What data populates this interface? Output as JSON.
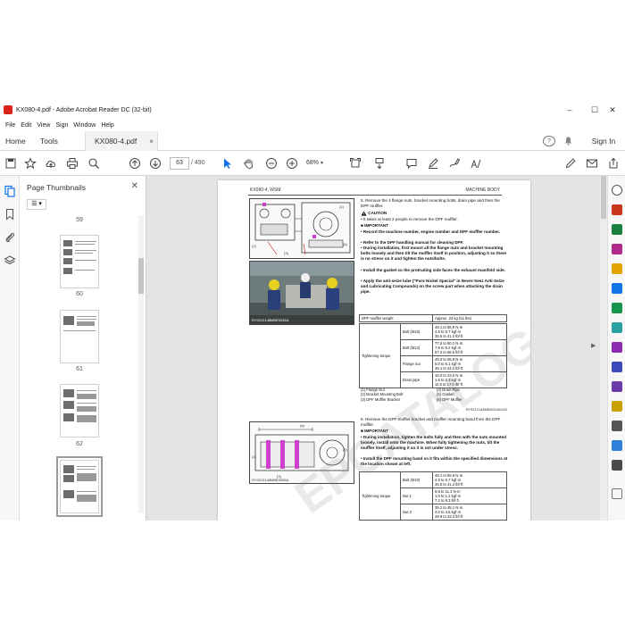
{
  "window": {
    "title": "KX080-4.pdf - Adobe Acrobat Reader DC (32-bit)",
    "controls": [
      "–",
      "☐",
      "✕"
    ]
  },
  "menu": [
    "File",
    "Edit",
    "View",
    "Sign",
    "Window",
    "Help"
  ],
  "tabs": {
    "home": "Home",
    "tools": "Tools",
    "document": "KX080-4.pdf",
    "close_glyph": "×",
    "help_glyph": "?",
    "signin": "Sign In"
  },
  "toolbar": {
    "current_page": "63",
    "page_total": "/ 490",
    "zoom": "68%"
  },
  "thumbnails": {
    "title": "Page Thumbnails",
    "close_glyph": "✕",
    "options_glyph": "☰ ▾",
    "items": [
      {
        "label": "59"
      },
      {
        "label": "60"
      },
      {
        "label": "61"
      },
      {
        "label": "62"
      },
      {
        "label": "63"
      }
    ]
  },
  "doc": {
    "header_left": "KX080-4, WSM",
    "header_right": "MACHINE BODY",
    "step5_text": "5. Remove the 4 flange nuts, bracket mounting bolts, drain pipe and then the DPF muffler.",
    "caution_label": "CAUTION",
    "caution_text": "• It takes at least 2 people to remove the DPF muffler.",
    "important_label": "IMPORTANT",
    "important_items": [
      "• Record the machine number, engine number and DPF muffler number.",
      "• Refer to the DPF handling manual for cleaning DPF.",
      "• During installation, first mount all the flange nuts and bracket mounting bolts loosely and then tilt the muffler itself in position, adjusting it so there is no stress on it and tighten the nuts/bolts.",
      "• Install the gasket so the protruding side faces the exhaust manifold side.",
      "• Apply the anti-seize lube (\"Pure Nickel Special\" in Never-Seez Anti-Seize and Lubricating Compounds) on the screw part when attaching the drain pipe."
    ],
    "fig1_caption": "RY9212148MBE0034A",
    "fig2_caption": "RY9212148MBE0035A",
    "weight_table": {
      "label": "DPF muffler weight",
      "value": "Approx. 23 kg (51 lbs)"
    },
    "torque_table1": {
      "label": "Tightening torque",
      "rows": [
        {
          "item": "Bolt (M10)",
          "values": [
            "48.1 to 55.9 N·m",
            "4.9 to 5.7 kgf·m",
            "35.5 to 41.2 lbf·ft"
          ]
        },
        {
          "item": "Bolt (M12)",
          "values": [
            "77.5 to 90.2 N·m",
            "7.9 to 9.2 kgf·m",
            "57.2 to 66.5 lbf·ft"
          ]
        },
        {
          "item": "Flange nut",
          "values": [
            "49.0 to 55.9 N·m",
            "5.0 to 6.1 kgf·m",
            "36.1 to 44.2 lbf·ft"
          ]
        },
        {
          "item": "Drain pipe",
          "values": [
            "16.0 to 23.0 N·m",
            "1.6 to 2.3 kgf·m",
            "11.8 to 17.0 lbf·ft"
          ]
        }
      ]
    },
    "legend1": [
      "(1) Flange Nut",
      "(4) Drain Pipe",
      "(2) Bracket Mounting Bolt",
      "(5) Gasket",
      "(3) DPF Muffler Bracket",
      "(6) DPF Muffler"
    ],
    "ref1": "RY9212148MBS0040US0",
    "step6_text": "6. Remove the DPF muffler bracket and muffler mounting band from the DPF muffler.",
    "important2_label": "IMPORTANT",
    "important2_items": [
      "• During installation, tighten the bolts fully and then with the nuts mounted loosely, install onto the machine. When fully tightening the nuts, tilt the muffler itself, adjusting it so it is not under stress.",
      "• Install the DPF mounting band so it fits within the specified dimensions at the location shown at left."
    ],
    "fig3_caption": "RY9212148MBE0036A",
    "fig3_label": "(a)",
    "torque_table2": {
      "label": "Tightening torque",
      "rows": [
        {
          "item": "Bolt (M10)",
          "values": [
            "48.1 to 55.9 N·m",
            "4.9 to 5.7 kgf·m",
            "35.5 to 41.2 lbf·ft"
          ]
        },
        {
          "item": "Nut 1",
          "values": [
            "9.8 to 11.3 N·m",
            "1.0 to 1.2 kgf·m",
            "7.2 to 8.3 lbf·ft"
          ]
        },
        {
          "item": "Nut 2",
          "values": [
            "39.2 to 45.1 N·m",
            "4.0 to 4.6 kgf·m",
            "28.9 to 33.3 lbf·ft"
          ]
        }
      ]
    },
    "watermark": "EPCATALOGS.COM"
  },
  "colors": {
    "acrobat_red": "#d9241c",
    "accent_blue": "#1473e6",
    "panel_bg": "#f0f0f0",
    "doc_bg": "#e4e4e4"
  }
}
